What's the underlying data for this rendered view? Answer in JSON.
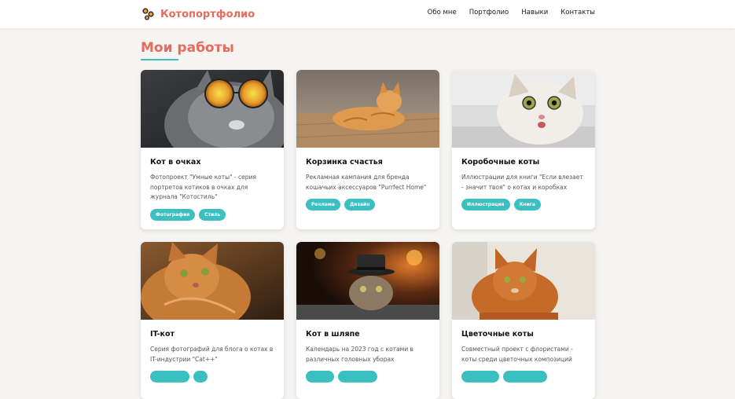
{
  "header": {
    "logo_text": "Котопортфолио",
    "nav": [
      "Обо мне",
      "Портфолио",
      "Навыки",
      "Контакты"
    ]
  },
  "section": {
    "title": "Мои работы"
  },
  "cards": [
    {
      "title": "Кот в очках",
      "desc": "Фотопроект \"Умные коты\" - серия портретов котиков в очках для журнала \"Котостиль\"",
      "tags": [
        "Фотография",
        "Стиль"
      ]
    },
    {
      "title": "Корзинка счастья",
      "desc": "Рекламная кампания для бренда кошачьих аксессуаров \"Purrfect Home\"",
      "tags": [
        "Реклама",
        "Дизайн"
      ]
    },
    {
      "title": "Коробочные коты",
      "desc": "Иллюстрации для книги \"Если влезает - значит твоя\" о котах и коробках",
      "tags": [
        "Иллюстрация",
        "Книга"
      ]
    },
    {
      "title": "IT-кот",
      "desc": "Серия фотографий для блога о котах в IT-индустрии \"Cat++\"",
      "tags": [
        "",
        ""
      ]
    },
    {
      "title": "Кот в шляпе",
      "desc": "Календарь на 2023 год с котами в различных головных уборах",
      "tags": [
        "",
        ""
      ]
    },
    {
      "title": "Цветочные коты",
      "desc": "Совместный проект с флористами - коты среди цветочных композиций",
      "tags": [
        "",
        ""
      ]
    }
  ],
  "colors": {
    "accent": "#e86a5b",
    "tag": "#3bbfc1"
  }
}
